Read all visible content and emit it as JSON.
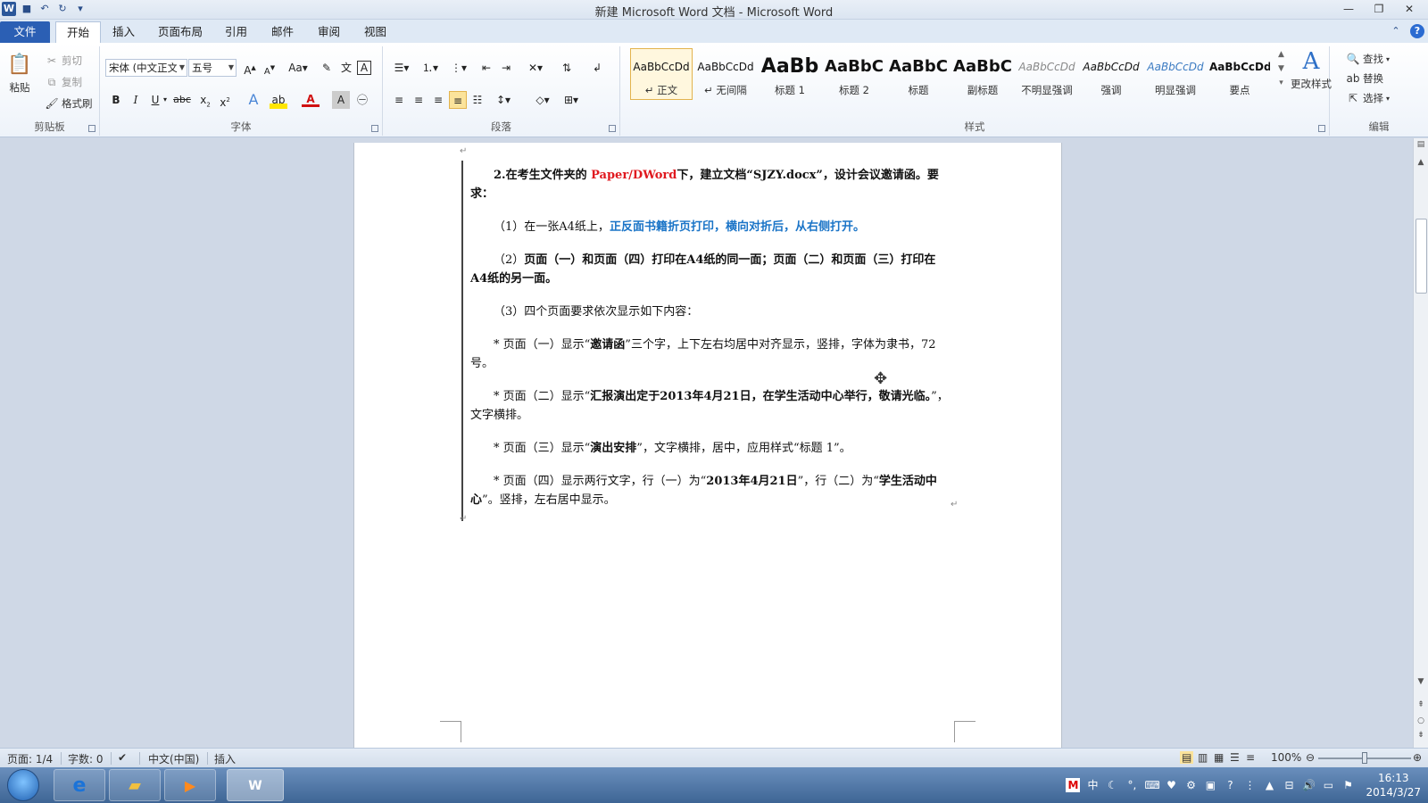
{
  "window": {
    "title": "新建 Microsoft Word 文档 - Microsoft Word"
  },
  "ribbon_tabs": {
    "file": "文件",
    "items": [
      "开始",
      "插入",
      "页面布局",
      "引用",
      "邮件",
      "审阅",
      "视图"
    ]
  },
  "clipboard": {
    "paste": "粘贴",
    "cut": "剪切",
    "copy": "复制",
    "format_painter": "格式刷",
    "label": "剪贴板"
  },
  "font": {
    "name": "宋体 (中文正文)",
    "size": "五号",
    "label": "字体"
  },
  "paragraph": {
    "label": "段落"
  },
  "styles": {
    "items": [
      {
        "preview": "AaBbCcDd",
        "name": "↵ 正文"
      },
      {
        "preview": "AaBbCcDd",
        "name": "↵ 无间隔"
      },
      {
        "preview": "AaBb",
        "name": "标题 1"
      },
      {
        "preview": "AaBbC",
        "name": "标题 2"
      },
      {
        "preview": "AaBbC",
        "name": "标题"
      },
      {
        "preview": "AaBbC",
        "name": "副标题"
      },
      {
        "preview": "AaBbCcDd",
        "name": "不明显强调"
      },
      {
        "preview": "AaBbCcDd",
        "name": "强调"
      },
      {
        "preview": "AaBbCcDd",
        "name": "明显强调"
      },
      {
        "preview": "AaBbCcDd",
        "name": "要点"
      }
    ],
    "change_styles": "更改样式",
    "label": "样式"
  },
  "editing": {
    "find": "查找",
    "replace": "替换",
    "select": "选择",
    "label": "编辑"
  },
  "document": {
    "p1_a": "2.在考生文件夹的 ",
    "p1_red": "Paper/DWord",
    "p1_b": "下，建立文档“SJZY.docx”，设计会议邀请函。要求：",
    "p2_a": "（1）在一张A4纸上，",
    "p2_blue": "正反面书籍折页打印，横向对折后，从右侧打开。",
    "p3_a": "（2）",
    "p3_b": "页面（一）和页面（四）打印在A4纸的同一面；页面（二）和页面（三）打印在A4纸的另一面。",
    "p4": "（3）四个页面要求依次显示如下内容：",
    "p5_a": "* 页面（一）显示“",
    "p5_b": "邀请函",
    "p5_c": "”三个字，上下左右均居中对齐显示，竖排，字体为隶书，72号。",
    "p6_a": "* 页面（二）显示“",
    "p6_b": "汇报演出定于2013年4月21日，在学生活动中心举行，敬请光临。",
    "p6_c": "”，文字横排。",
    "p7_a": "* 页面（三）显示“",
    "p7_b": "演出安排",
    "p7_c": "”，文字横排，居中，应用样式“标题 1”。",
    "p8_a": "* 页面（四）显示两行文字，行（一）为“",
    "p8_b": "2013年4月21日",
    "p8_c": "”，行（二）为“",
    "p8_d": "学生活动中心",
    "p8_e": "”。竖排，左右居中显示。"
  },
  "statusbar": {
    "page": "页面: 1/4",
    "words": "字数: 0",
    "language": "中文(中国)",
    "mode": "插入",
    "zoom": "100%"
  },
  "taskbar": {
    "time": "16:13",
    "date": "2014/3/27"
  }
}
